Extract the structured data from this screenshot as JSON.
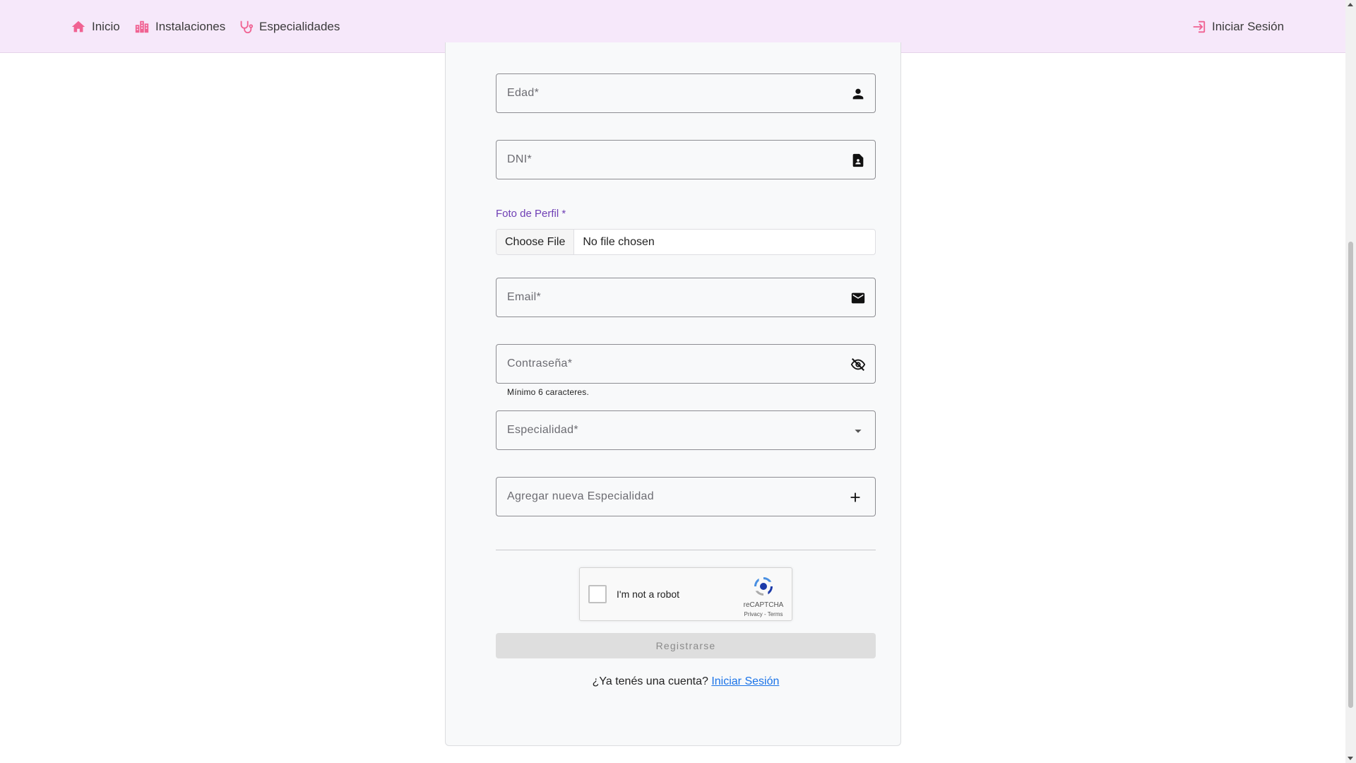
{
  "nav": {
    "home": "Inicio",
    "facilities": "Instalaciones",
    "specialties": "Especialidades",
    "login": "Iniciar Sesión"
  },
  "form": {
    "age_placeholder": "Edad*",
    "dni_placeholder": "DNI*",
    "photo_label": "Foto de Perfil *",
    "file_button": "Choose File",
    "file_status": "No file chosen",
    "email_placeholder": "Email*",
    "password_placeholder": "Contraseña*",
    "password_hint": "Mínimo 6 caracteres.",
    "specialty_placeholder": "Especialidad*",
    "new_specialty_placeholder": "Agregar nueva Especialidad",
    "submit_label": "Registrarse",
    "account_question": "¿Ya tenés una cuenta?",
    "account_link": "Iniciar Sesión"
  },
  "recaptcha": {
    "label": "I'm not a robot",
    "brand": "reCAPTCHA",
    "links": "Privacy - Terms"
  },
  "icons": {
    "home": "home-icon",
    "facilities": "buildings-icon",
    "specialties": "stethoscope-icon",
    "login": "login-icon",
    "age": "person-icon",
    "dni": "id-card-icon",
    "email": "mail-icon",
    "password": "eye-off-icon",
    "specialty": "dropdown-arrow-icon",
    "new_specialty": "plus-icon"
  },
  "colors": {
    "navbar_bg": "#f6e8fa",
    "accent_pink": "#f06292",
    "label_purple": "#6f3fb5",
    "link_blue": "#1a73e8"
  }
}
